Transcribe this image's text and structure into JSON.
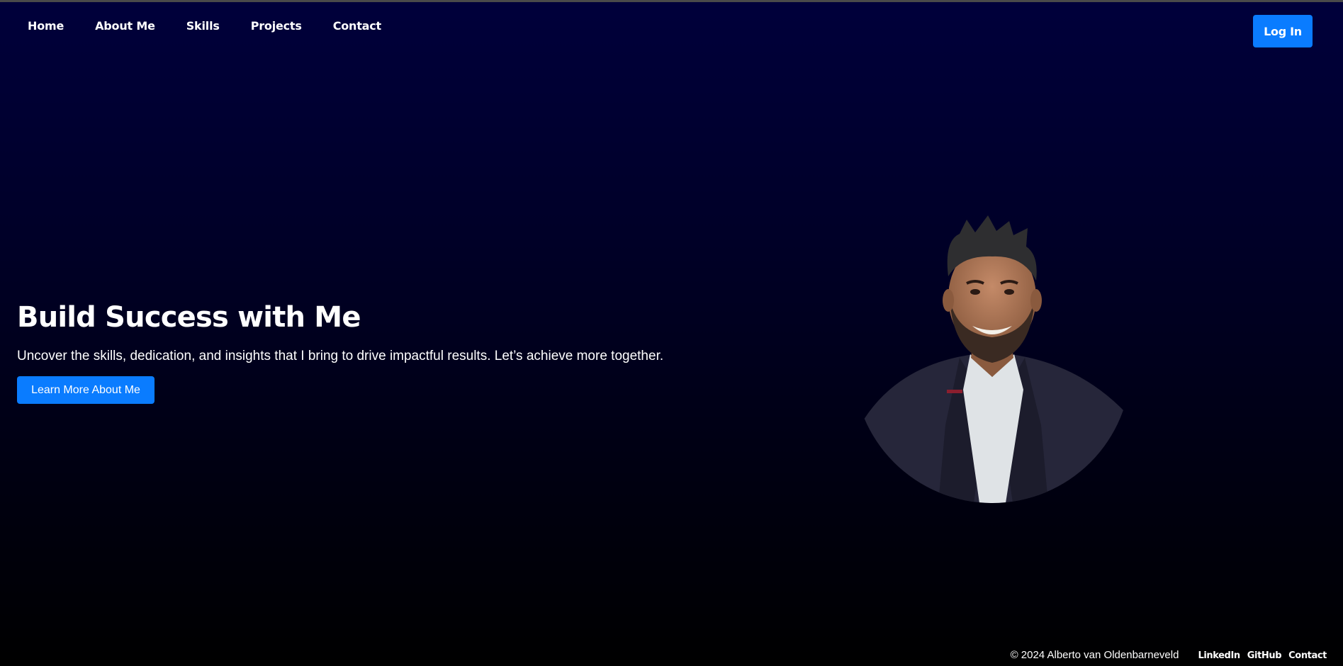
{
  "nav": {
    "links": [
      "Home",
      "About Me",
      "Skills",
      "Projects",
      "Contact"
    ],
    "login_label": "Log In"
  },
  "hero": {
    "title": "Build Success with Me",
    "subtitle": "Uncover the skills, dedication, and insights that I bring to drive impactful results. Let’s achieve more together.",
    "cta_label": "Learn More About Me"
  },
  "footer": {
    "copyright": "© 2024 Alberto van Oldenbarneveld",
    "links": [
      "LinkedIn",
      "GitHub",
      "Contact"
    ]
  },
  "colors": {
    "accent": "#0a7cff",
    "background_top": "#00003b",
    "background_bottom": "#000000",
    "text": "#ffffff"
  },
  "icons": {
    "portrait": "profile-photo"
  }
}
